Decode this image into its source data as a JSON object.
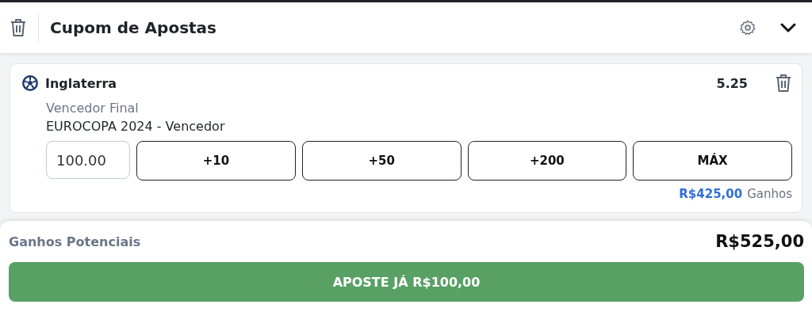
{
  "header": {
    "title": "Cupom de Apostas"
  },
  "bet": {
    "team": "Inglaterra",
    "odds": "5.25",
    "market": "Vencedor Final",
    "event": "EUROCOPA 2024 - Vencedor",
    "stake": "100.00",
    "quick_stakes": [
      "+10",
      "+50",
      "+200",
      "MÁX"
    ],
    "winnings": "R$425,00",
    "winnings_label": "Ganhos"
  },
  "footer": {
    "label": "Ganhos Potenciais",
    "total": "R$525,00",
    "button": "APOSTE JÁ R$100,00"
  }
}
